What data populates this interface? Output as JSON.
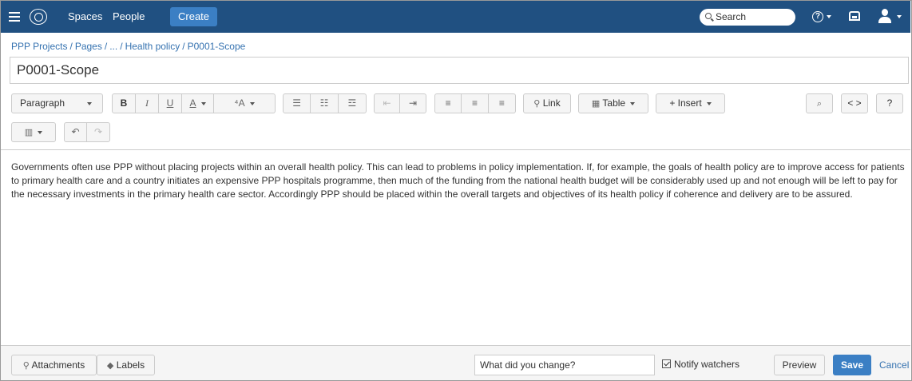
{
  "topbar": {
    "spaces": "Spaces",
    "people": "People",
    "create": "Create",
    "search_placeholder": "Search",
    "help_glyph": "?"
  },
  "breadcrumb": [
    "PPP Projects",
    "Pages",
    "...",
    "Health policy",
    "P0001-Scope"
  ],
  "page_title": "P0001-Scope",
  "toolbar": {
    "paragraph": "Paragraph",
    "bold": "B",
    "italic": "I",
    "underline": "U",
    "text_color": "A",
    "more_format": "⁴A",
    "link": "Link",
    "table": "Table",
    "insert": "+ Insert",
    "source": "< >",
    "help": "?"
  },
  "content": {
    "body": "Governments often use PPP without placing projects within an overall health policy. This can lead to problems in policy implementation. If, for example, the goals of health policy are to improve access for patients to primary health care and a country initiates an expensive PPP hospitals programme, then much of the funding from the national health budget will be considerably used up and not enough will be left to pay for the necessary investments in the primary health care sector. Accordingly PPP should be placed within the overall targets and objectives of its health policy if coherence and delivery are to be assured."
  },
  "footer": {
    "attachments": "Attachments",
    "labels": "Labels",
    "change_placeholder": "What did you change?",
    "notify_watchers": "Notify watchers",
    "notify_checked": true,
    "preview": "Preview",
    "save": "Save",
    "cancel": "Cancel"
  },
  "colors": {
    "topbar": "#205081",
    "primary_button": "#3b7fc4",
    "link": "#3572b0"
  }
}
